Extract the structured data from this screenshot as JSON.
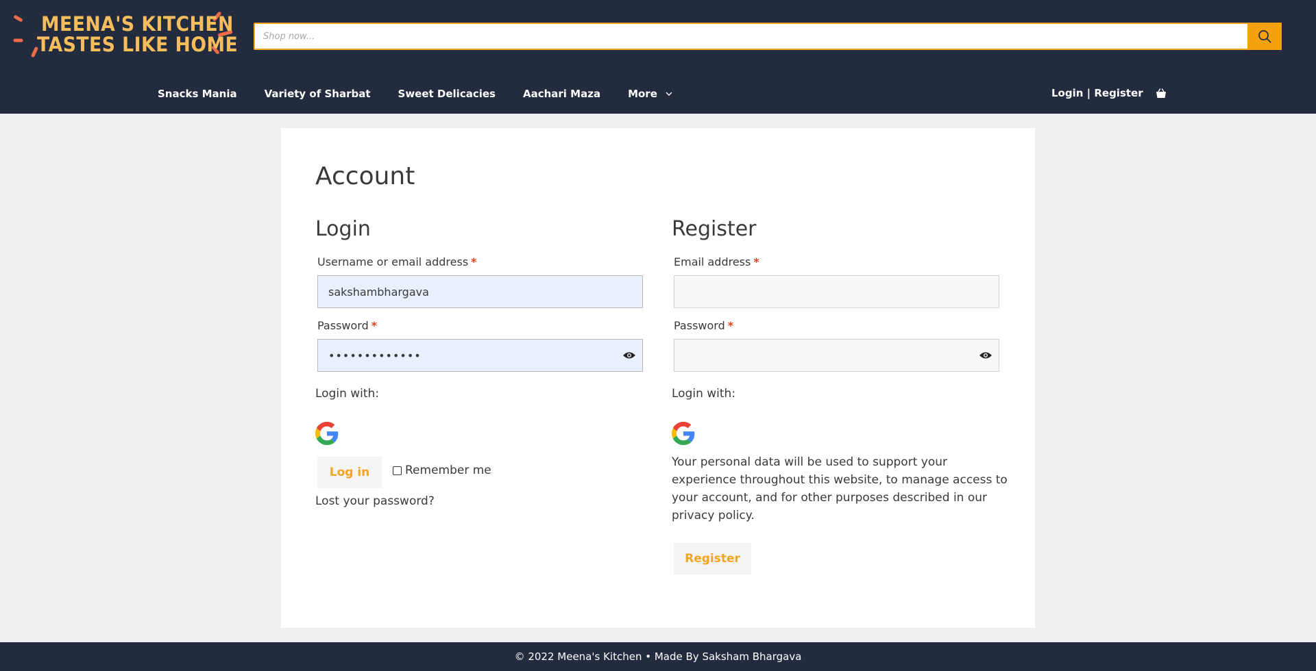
{
  "header": {
    "logo": {
      "line1": "MEENA'S KITCHEN",
      "line2": "TASTES LIKE HOME"
    },
    "search": {
      "placeholder": "Shop now..."
    },
    "nav": [
      {
        "label": "Snacks Mania"
      },
      {
        "label": "Variety of Sharbat"
      },
      {
        "label": "Sweet Delicacies"
      },
      {
        "label": "Aachari Maza"
      },
      {
        "label": "More"
      }
    ],
    "account_link": "Login | Register"
  },
  "page": {
    "title": "Account",
    "login": {
      "title": "Login",
      "username_label": "Username or email address",
      "username_value": "sakshambhargava",
      "password_label": "Password",
      "password_value": "•••••••••••••",
      "login_with": "Login with:",
      "login_button": "Log in",
      "remember_label": "Remember me",
      "lost_password": "Lost your password?"
    },
    "register": {
      "title": "Register",
      "email_label": "Email address",
      "password_label": "Password",
      "login_with": "Login with:",
      "privacy_text": "Your personal data will be used to support your experience throughout this website, to manage access to your account, and for other purposes described in our privacy policy.",
      "register_button": "Register"
    },
    "required_mark": "*"
  },
  "footer": {
    "text": "© 2022 Meena's Kitchen • Made By Saksham Bhargava"
  },
  "colors": {
    "header_bg": "#222c3e",
    "accent": "#f5a00f",
    "logo": "#f6bd5c",
    "autofill_bg": "#e8f0fe"
  },
  "icons": [
    "search-icon",
    "chevron-down-icon",
    "cart-icon",
    "eye-icon",
    "google-icon"
  ]
}
